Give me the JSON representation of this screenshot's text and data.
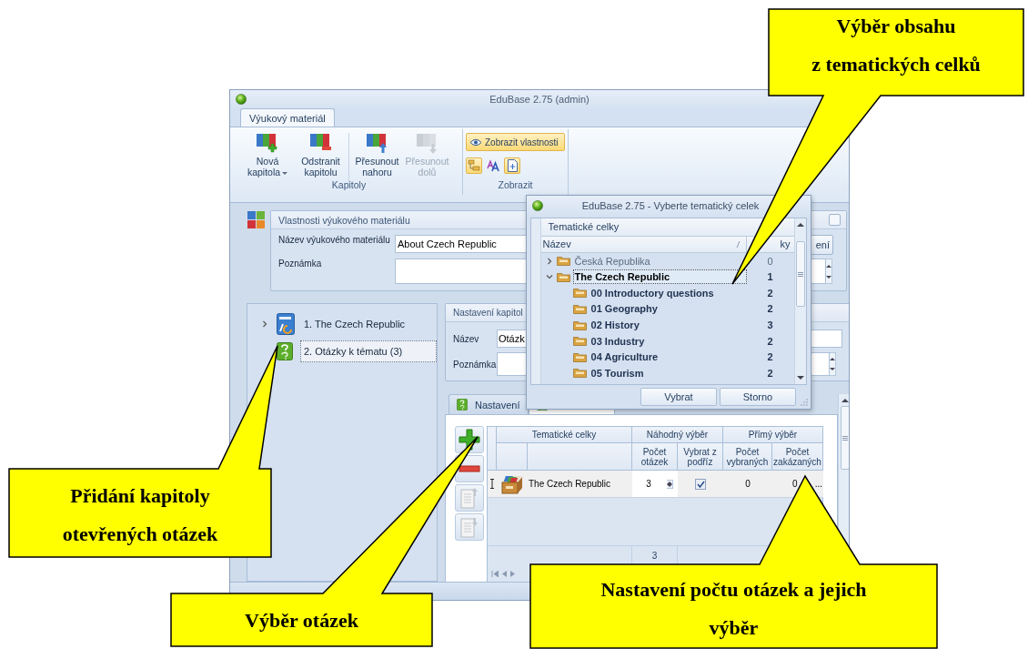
{
  "window": {
    "title": "EduBase 2.75 (admin)"
  },
  "ribbon": {
    "tabs": [
      {
        "label": "Výukový materiál",
        "selected": true
      }
    ],
    "groups": [
      {
        "label": "Kapitoly",
        "buttons": [
          {
            "kind": "add",
            "label": "Nová kapitola",
            "dropdown": true,
            "disabled": false
          },
          {
            "kind": "remove",
            "label": "Odstranit kapitolu",
            "dropdown": false,
            "disabled": false
          },
          {
            "kind": "up",
            "label": "Přesunout nahoru",
            "dropdown": false,
            "disabled": false
          },
          {
            "kind": "down",
            "label": "Přesunout dolů",
            "dropdown": false,
            "disabled": true
          }
        ]
      },
      {
        "label": "Zobrazit",
        "toggles": [
          {
            "kind": "properties",
            "label": "Zobrazit vlastnosti",
            "on": true
          },
          {
            "kind": "folders",
            "on": true
          },
          {
            "kind": "font",
            "on": false
          },
          {
            "kind": "page",
            "on": true
          }
        ]
      }
    ]
  },
  "material": {
    "title": "Vlastnosti výukového materiálu",
    "name_label": "Název výukového materiálu",
    "name_value": "About Czech Republic",
    "note_label": "Poznámka",
    "button": "ení",
    "checked": false
  },
  "chapters": [
    {
      "kind": "text",
      "label": "1. The Czech Republic",
      "collapsed": true,
      "selected": false
    },
    {
      "kind": "questions",
      "label": "2. Otázky k tématu (3)",
      "collapsed": false,
      "selected": true
    }
  ],
  "chapter_settings": {
    "title": "Nastavení kapitol",
    "name_label": "Název",
    "name_value": "Otázk",
    "note_label": "Poznámka"
  },
  "tabs": [
    {
      "label": "Nastavení",
      "selected": false
    },
    {
      "selected": true
    }
  ],
  "question_grid": {
    "bands": [
      "Tematické celky",
      "Náhodný výběr",
      "Přímý výběr"
    ],
    "columns": [
      "Počet otázek",
      "Vybrat z podříz",
      "Počet vybraných",
      "Počet zakázaných"
    ],
    "rows": [
      {
        "name": "The Czech Republic",
        "count": "3",
        "checked": true,
        "chosen": "0",
        "excluded": "0",
        "more": "..."
      }
    ],
    "total": "3"
  },
  "dialog": {
    "title": "EduBase 2.75 - Vyberte tematický celek",
    "band": "Tematické celky",
    "columns": [
      "Název",
      "ky"
    ],
    "rows": [
      {
        "name": "Česká Republika",
        "count": "0",
        "expanded": false,
        "selected": false,
        "disabled": true
      },
      {
        "name": "The Czech Republic",
        "count": "1",
        "expanded": true,
        "selected": true,
        "disabled": false,
        "children": [
          {
            "name": "00 Introductory questions",
            "count": "2",
            "selected": false,
            "disabled": false
          },
          {
            "name": "01 Geography",
            "count": "2",
            "selected": false,
            "disabled": false
          },
          {
            "name": "02 History",
            "count": "3",
            "selected": false,
            "disabled": false
          },
          {
            "name": "03 Industry",
            "count": "2",
            "selected": false,
            "disabled": false
          },
          {
            "name": "04 Agriculture",
            "count": "2",
            "selected": false,
            "disabled": false
          },
          {
            "name": "05 Tourism",
            "count": "2",
            "selected": false,
            "disabled": false
          }
        ]
      }
    ],
    "buttons": [
      "Vybrat",
      "Storno"
    ]
  },
  "callouts": [
    {
      "text": "Výběr obsahu\nz tematických celků"
    },
    {
      "text": "Přidání kapitoly\notevřených otázek"
    },
    {
      "text": "Výběr otázek"
    },
    {
      "text": "Nastavení počtu otázek a jejich\nvýběr"
    }
  ]
}
